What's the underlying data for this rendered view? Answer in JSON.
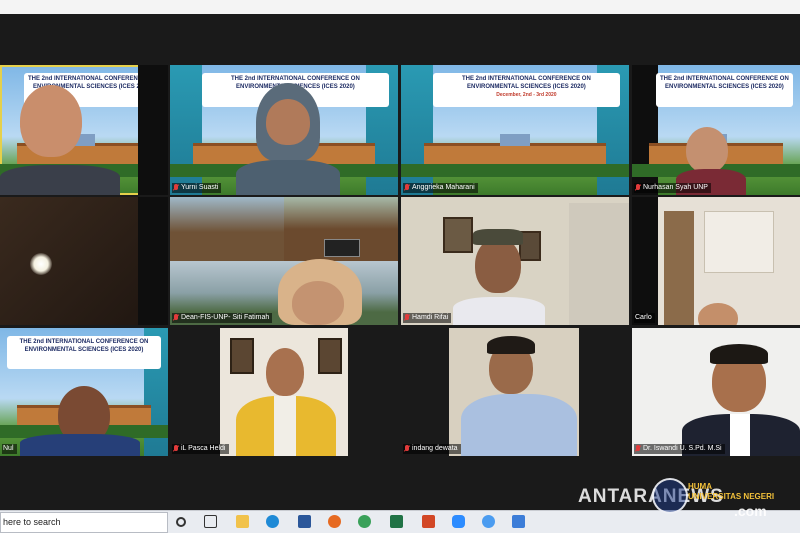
{
  "participants": [
    {
      "name": ""
    },
    {
      "name": "Yurni Suasti"
    },
    {
      "name": "Anggrieka Maharani"
    },
    {
      "name": "Nurhasan Syah UNP"
    },
    {
      "name": ""
    },
    {
      "name": "Dean-FIS-UNP- Siti Fatimah"
    },
    {
      "name": "Hamdi Rifai"
    },
    {
      "name": "Carlo"
    },
    {
      "name": "Nul"
    },
    {
      "name": "iL Pasca Heldi"
    },
    {
      "name": "indang dewata"
    },
    {
      "name": "Dr. Iswandi U. S.Pd. M.Si"
    }
  ],
  "banner": {
    "title_line1": "THE 2nd INTERNATIONAL CONFERENCE ON",
    "title_line2": "ENVIRONMENTAL SCIENCES (ICES 2020)",
    "date": "December, 2nd - 3rd 2020"
  },
  "taskbar": {
    "search_text": "here to search"
  },
  "watermark": {
    "brand": "ANTARANEWS",
    "sub1": "HUMA",
    "sub2": "UNIVERSITAS NEGERI",
    "domain": ".com"
  }
}
